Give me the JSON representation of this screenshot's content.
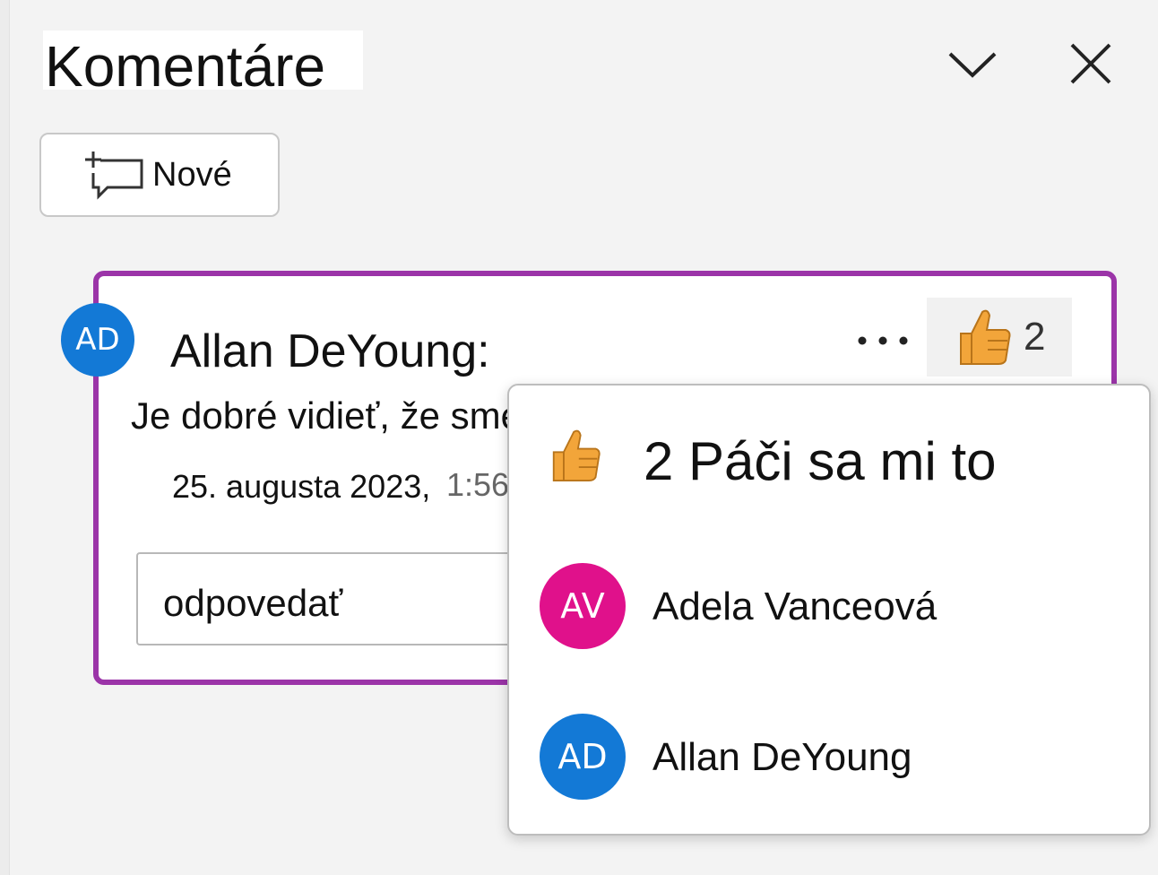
{
  "panel": {
    "title": "Komentáre"
  },
  "toolbar": {
    "new_label": "Nové"
  },
  "comment": {
    "author": "Allan DeYoung:",
    "initials": "AD",
    "avatar_color": "#1379d6",
    "text": "Je dobré vidieť, že sme",
    "date": "25. augusta 2023,",
    "time": "1:56",
    "like_count": "2",
    "reply_placeholder": "odpovedať"
  },
  "likes_popup": {
    "title": "2 Páči sa mi to",
    "people": [
      {
        "initials": "AV",
        "name": "Adela Vanceová",
        "color": "#e0118b"
      },
      {
        "initials": "AD",
        "name": "Allan DeYoung",
        "color": "#1379d6"
      }
    ]
  },
  "colors": {
    "accent": "#9b34a8",
    "like": "#f2a53a"
  },
  "icons": [
    "chevron-down-icon",
    "close-icon",
    "new-comment-icon",
    "more-options-icon",
    "thumbs-up-icon"
  ]
}
